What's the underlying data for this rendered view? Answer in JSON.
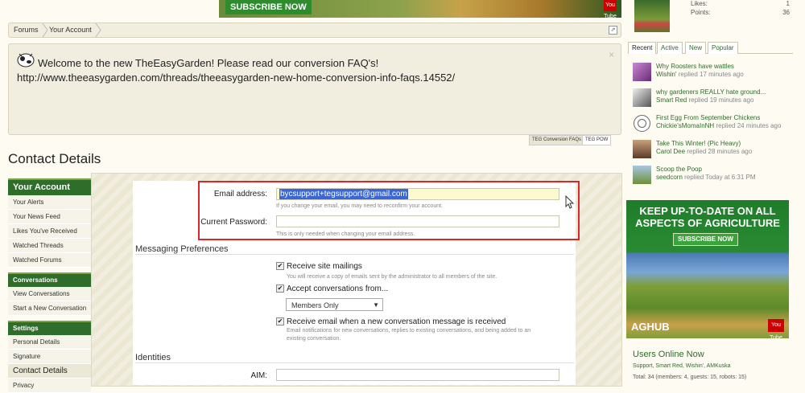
{
  "banner_top": {
    "subscribe_label": "SUBSCRIBE NOW",
    "youtube_label": "You Tube"
  },
  "breadcrumb": {
    "items": [
      "Forums",
      "Your Account"
    ]
  },
  "notice": {
    "message": "Welcome to the new TheEasyGarden! Please read our conversion FAQ's!",
    "url": "http://www.theeasygarden.com/threads/theeasygarden-new-home-conversion-info-faqs.14552/",
    "close": "×",
    "tabs": [
      "TEG Conversion FAQs",
      "TEG POW"
    ]
  },
  "page_title": "Contact Details",
  "sidebar": {
    "your_account": {
      "heading": "Your Account",
      "items": [
        "Your Alerts",
        "Your News Feed",
        "Likes You've Received",
        "Watched Threads",
        "Watched Forums"
      ]
    },
    "conversations": {
      "heading": "Conversations",
      "items": [
        "View Conversations",
        "Start a New Conversation"
      ]
    },
    "settings": {
      "heading": "Settings",
      "items": [
        "Personal Details",
        "Signature",
        "Contact Details",
        "Privacy"
      ]
    }
  },
  "form": {
    "email_label": "Email address:",
    "email_value": "bycsupport+tegsupport@gmail.com",
    "email_hint": "If you change your email, you may need to reconfirm your account.",
    "password_label": "Current Password:",
    "password_value": "",
    "password_hint": "This is only needed when changing your email address.",
    "messaging_heading": "Messaging Preferences",
    "receive_mailings_label": "Receive site mailings",
    "receive_mailings_checked": true,
    "receive_mailings_hint": "You will receive a copy of emails sent by the administrator to all members of the site.",
    "accept_conversations_label": "Accept conversations from...",
    "accept_conversations_checked": true,
    "accept_from_selected": "Members Only",
    "email_on_conversation_label": "Receive email when a new conversation message is received",
    "email_on_conversation_checked": true,
    "email_on_conversation_hint_1": "Email notifications for new conversations, replies to existing conversations, and being added to an",
    "email_on_conversation_hint_2": "existing conversation.",
    "identities_heading": "Identities",
    "aim_label": "AIM:",
    "aim_value": ""
  },
  "profile_stats": {
    "likes_label": "Likes:",
    "likes_value": "1",
    "points_label": "Points:",
    "points_value": "36"
  },
  "activity_tabs": [
    "Recent",
    "Active",
    "New",
    "Popular"
  ],
  "recent_threads": [
    {
      "title": "Why Roosters have wattles",
      "user": "Wishin'",
      "time": "replied 17 minutes ago"
    },
    {
      "title": "why gardeners REALLY hate ground...",
      "user": "Smart Red",
      "time": "replied 19 minutes ago"
    },
    {
      "title": "First Egg From September Chickens",
      "user": "Chickie'sMomaInNH",
      "time": "replied 24 minutes ago"
    },
    {
      "title": "Take This Winter! (Pic Heavy)",
      "user": "Carol Dee",
      "time": "replied 28 minutes ago"
    },
    {
      "title": "Scoop the Poop",
      "user": "seedcorn",
      "time": "replied Today at 6:31 PM"
    }
  ],
  "ad": {
    "headline": "KEEP UP-TO-DATE ON ALL ASPECTS OF AGRICULTURE",
    "subscribe_label": "SUBSCRIBE NOW",
    "logo": "AGHUB",
    "youtube_label": "You Tube"
  },
  "users_online": {
    "title": "Users Online Now",
    "names": "Support, Smart Red, Wishin', AMKuska",
    "total": "Total: 34 (members: 4, guests: 15, robots: 15)"
  },
  "colors": {
    "nav_green": "#2f6d2a",
    "highlight_red": "#d8262b",
    "selection_blue": "#3a66d6"
  }
}
